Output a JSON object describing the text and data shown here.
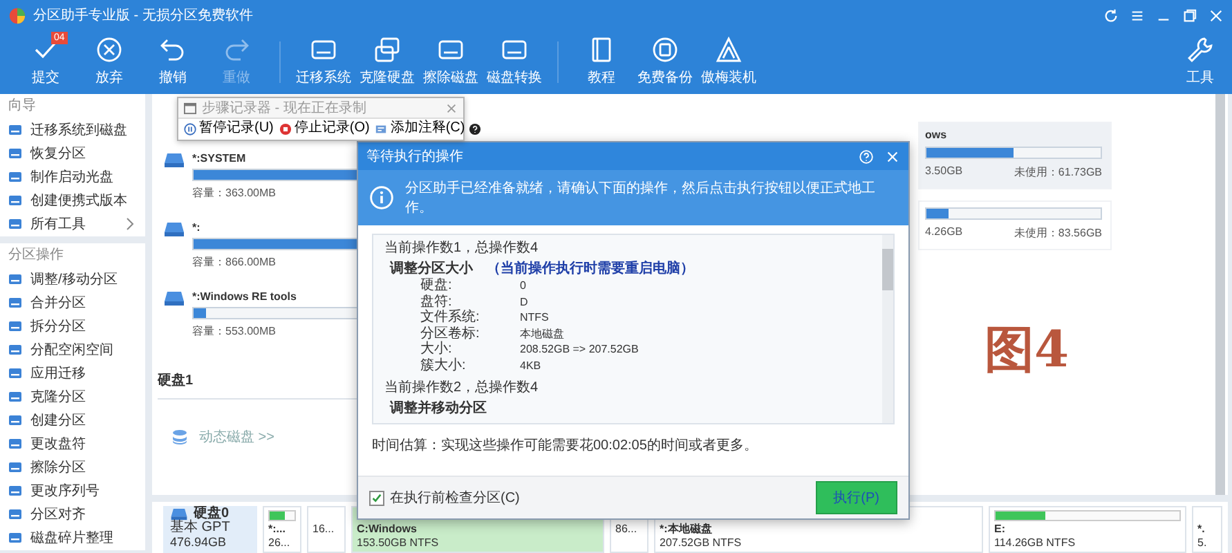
{
  "window": {
    "title": "分区助手专业版 - 无损分区免费软件"
  },
  "toolbar": {
    "groups": [
      [
        {
          "label": "提交",
          "kind": "check",
          "badge": "04",
          "disabled": false
        },
        {
          "label": "放弃",
          "kind": "cancel",
          "disabled": false
        },
        {
          "label": "撤销",
          "kind": "undo",
          "disabled": false
        },
        {
          "label": "重做",
          "kind": "redo",
          "disabled": true
        }
      ],
      [
        {
          "label": "迁移系统",
          "kind": "drive",
          "disabled": false
        },
        {
          "label": "克隆硬盘",
          "kind": "copy",
          "disabled": false
        },
        {
          "label": "擦除磁盘",
          "kind": "drive",
          "disabled": false
        },
        {
          "label": "磁盘转换",
          "kind": "drive",
          "disabled": false
        }
      ],
      [
        {
          "label": "教程",
          "kind": "book",
          "disabled": false
        },
        {
          "label": "免费备份",
          "kind": "backup",
          "disabled": false
        },
        {
          "label": "傲梅装机",
          "kind": "logo",
          "disabled": false
        }
      ]
    ],
    "tools": "工具"
  },
  "recorder": {
    "title": "步骤记录器 - 现在正在录制",
    "buttons": [
      {
        "label": "暂停记录(U)",
        "kind": "pause"
      },
      {
        "label": "停止记录(O)",
        "kind": "stop"
      },
      {
        "label": "添加注释(C)",
        "kind": "note"
      }
    ]
  },
  "sidebar": {
    "sections": [
      {
        "title": "向导",
        "items": [
          {
            "label": "迁移系统到磁盘",
            "submenu": false
          },
          {
            "label": "恢复分区",
            "submenu": false
          },
          {
            "label": "制作启动光盘",
            "submenu": false
          },
          {
            "label": "创建便携式版本",
            "submenu": false
          },
          {
            "label": "所有工具",
            "submenu": true
          }
        ]
      },
      {
        "title": "分区操作",
        "items": [
          {
            "label": "调整/移动分区",
            "submenu": false
          },
          {
            "label": "合并分区",
            "submenu": false
          },
          {
            "label": "拆分分区",
            "submenu": false
          },
          {
            "label": "分配空闲空间",
            "submenu": false
          },
          {
            "label": "应用迁移",
            "submenu": false
          },
          {
            "label": "克隆分区",
            "submenu": false
          },
          {
            "label": "创建分区",
            "submenu": false
          },
          {
            "label": "更改盘符",
            "submenu": false
          },
          {
            "label": "擦除分区",
            "submenu": false
          },
          {
            "label": "更改序列号",
            "submenu": false
          },
          {
            "label": "分区对齐",
            "submenu": false
          },
          {
            "label": "磁盘碎片整理",
            "submenu": false
          }
        ]
      }
    ]
  },
  "partitions": {
    "left": [
      {
        "name": "*:SYSTEM",
        "level": 0.75,
        "capacity": "容量：363.00MB"
      },
      {
        "name": "*:",
        "level": 1.0,
        "capacity": "容量：866.00MB"
      },
      {
        "name": "*:Windows RE tools",
        "level": 0.04,
        "capacity": "容量：553.00MB"
      }
    ],
    "right": [
      {
        "name": "ows",
        "level": 0.5,
        "used": "3.50GB",
        "free": "未使用：61.73GB",
        "selected": true
      },
      {
        "level": 0.13,
        "used": "4.26GB",
        "free": "未使用：83.56GB",
        "selected": false
      }
    ]
  },
  "disk1": {
    "title": "硬盘1",
    "dynamic": "动态磁盘 >>"
  },
  "disk_map": {
    "disk": {
      "name": "硬盘0",
      "type": "基本 GPT",
      "size": "476.94GB"
    },
    "partitions": [
      {
        "name": "*:...",
        "size": "26...",
        "level": 0.6,
        "selected": false
      },
      {
        "size": "16...",
        "selected": false
      },
      {
        "name": "C:Windows",
        "size": "153.50GB NTFS",
        "selected": true
      },
      {
        "size": "86...",
        "selected": false
      },
      {
        "name": "*:本地磁盘",
        "size": "207.52GB NTFS",
        "selected": false
      },
      {
        "name": "E:",
        "size": "114.26GB NTFS",
        "level": 0.27,
        "selected": false
      },
      {
        "name": "*.",
        "size": "5.",
        "selected": false
      }
    ]
  },
  "figure_label": "图4",
  "dialog": {
    "title": "等待执行的操作",
    "info": "分区助手已经准备就绪，请确认下面的操作，然后点击执行按钮以便正式地工作。",
    "operations": [
      {
        "header": "当前操作数1，总操作数4",
        "title": "调整分区大小",
        "note": "（当前操作执行时需要重启电脑）",
        "fields": [
          {
            "label": "硬盘:",
            "value": "0"
          },
          {
            "label": "盘符:",
            "value": "D"
          },
          {
            "label": "文件系统:",
            "value": "NTFS"
          },
          {
            "label": "分区卷标:",
            "value": "本地磁盘"
          },
          {
            "label": "大小:",
            "value": "208.52GB => 207.52GB"
          },
          {
            "label": "簇大小:",
            "value": "4KB"
          }
        ]
      },
      {
        "header": "当前操作数2，总操作数4",
        "title": "调整并移动分区"
      }
    ],
    "estimate": "时间估算：实现这些操作可能需要花00:02:05的时间或者更多。",
    "check": {
      "label": "在执行前检查分区(C)",
      "checked": true
    },
    "execute": "执行(P)"
  }
}
